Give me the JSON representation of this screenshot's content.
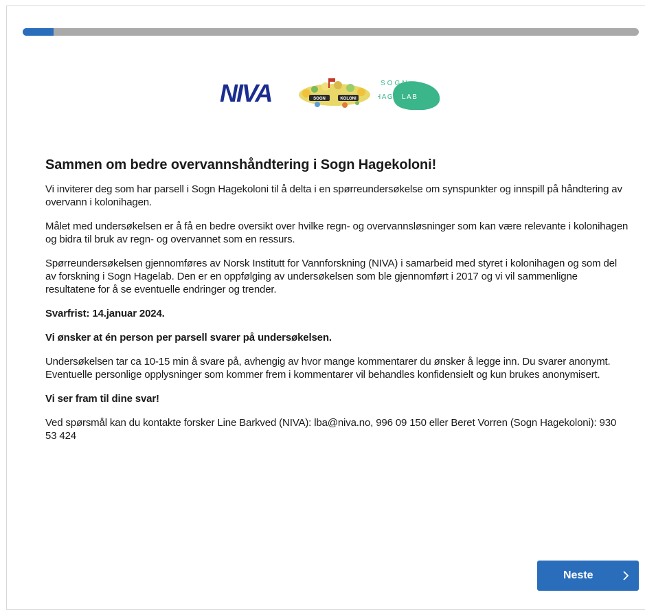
{
  "progress": {
    "fraction": 0.05
  },
  "logos": {
    "niva": "NIVA",
    "kolonien": "SOGN HAGEKOLONI",
    "sogn_top": "SOGN",
    "sogn_bottom_left": "HAGE",
    "sogn_bottom_right": "LAB",
    "sogn_color": "#3bb58a"
  },
  "content": {
    "title": "Sammen om bedre overvannshåndtering i Sogn Hagekoloni!",
    "paragraphs": [
      "Vi inviterer deg som har parsell i Sogn Hagekoloni til å delta i en spørreundersøkelse om synspunkter og innspill på håndtering av overvann i kolonihagen.",
      "Målet med undersøkelsen er å få en bedre oversikt over hvilke regn- og overvannsløsninger som kan være relevante i kolonihagen og bidra til bruk av regn- og overvannet som en ressurs.",
      "Spørreundersøkelsen gjennomføres av Norsk Institutt for Vannforskning (NIVA) i samarbeid med styret i kolonihagen og som del av forskning i Sogn Hagelab. Den er en oppfølging av undersøkelsen som ble gjennomført i 2017 og vi vil sammenligne resultatene for å se eventuelle endringer og trender.",
      "Svarfrist: 14.januar 2024.",
      "Vi ønsker at én person per parsell svarer på undersøkelsen.",
      "Undersøkelsen tar ca 10-15 min å svare på, avhengig av hvor mange kommentarer du ønsker å legge inn. Du svarer anonymt. Eventuelle personlige opplysninger som kommer frem i kommentarer vil behandles konfidensielt og kun brukes anonymisert.",
      "Vi ser fram til dine svar!",
      "Ved spørsmål kan du kontakte forsker Line Barkved (NIVA): lba@niva.no, 996 09 150 eller Beret Vorren (Sogn Hagekoloni): 930 53 424"
    ]
  },
  "footer": {
    "next_label": "Neste",
    "next_icon": "chevron-right-icon"
  },
  "colors": {
    "accent": "#2a6ebb",
    "progress_track": "#a9a9a9",
    "niva_blue": "#1b2d8f"
  }
}
